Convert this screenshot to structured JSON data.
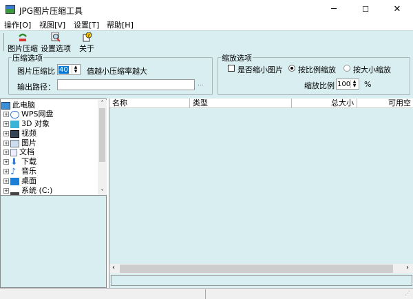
{
  "window": {
    "title": "JPG图片压缩工具",
    "minimize": "─",
    "maximize": "☐",
    "close": "✕"
  },
  "menu": [
    "操作[O]",
    "视图[V]",
    "设置[T]",
    "帮助[H]"
  ],
  "toolbar": {
    "compress": "图片压缩",
    "settings": "设置选项",
    "about": "关于"
  },
  "compress_options": {
    "legend": "压缩选项",
    "ratio_label": "图片压缩比",
    "ratio_value": "40",
    "hint": "值越小压缩率越大",
    "output_label": "输出路径：",
    "output_value": "",
    "browse": "..."
  },
  "scale_options": {
    "legend": "缩放选项",
    "shrink_label": "是否缩小图片",
    "shrink_checked": false,
    "by_ratio": "按比例缩放",
    "by_size": "按大小缩放",
    "selected": "按比例缩放",
    "ratio_label": "缩放比例",
    "ratio_value": "100",
    "unit": "%"
  },
  "tree": {
    "root": "此电脑",
    "items": [
      "WPS网盘",
      "3D 对象",
      "视频",
      "图片",
      "文档",
      "下载",
      "音乐",
      "桌面",
      "系统 (C:)"
    ]
  },
  "list": {
    "columns": [
      "名称",
      "类型",
      "总大小",
      "可用空"
    ]
  },
  "colors": {
    "panel": "#d9eef0"
  }
}
